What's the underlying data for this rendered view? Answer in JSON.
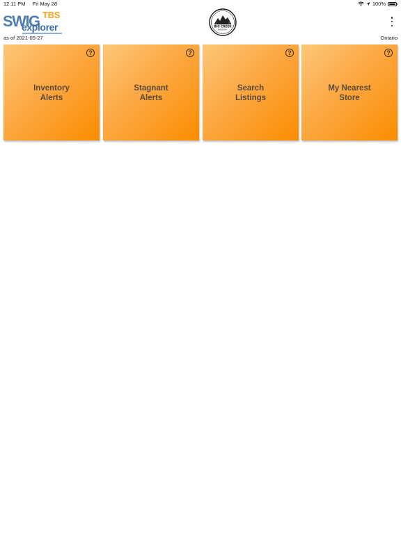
{
  "status_bar": {
    "time": "12:11 PM",
    "date": "Fri May 28",
    "battery": "100%",
    "battery_level": 1.0,
    "icons": [
      "wifi-icon",
      "location-arrow-icon",
      "battery-icon"
    ]
  },
  "header": {
    "logo": {
      "tbs": "TBS",
      "swig": "SWIG",
      "explorer": "explorer"
    },
    "as_of": "as of 2021-05-27",
    "region": "Ontario",
    "brewery_logo": {
      "name": "BIG CREEK",
      "subtitle": "BREWERY"
    },
    "menu_icon": "more-vertical-icon"
  },
  "tiles": [
    {
      "label": "Inventory\nAlerts",
      "help_label": "?"
    },
    {
      "label": "Stagnant\nAlerts",
      "help_label": "?"
    },
    {
      "label": "Search\nListings",
      "help_label": "?"
    },
    {
      "label": "My Nearest\nStore",
      "help_label": "?"
    }
  ],
  "colors": {
    "tile_gradient_start": "#fdc778",
    "tile_gradient_end": "#fb8d00",
    "tile_text": "#5a4a3c",
    "logo_blue": "#3c6fa8",
    "logo_orange": "#f2a51c"
  }
}
